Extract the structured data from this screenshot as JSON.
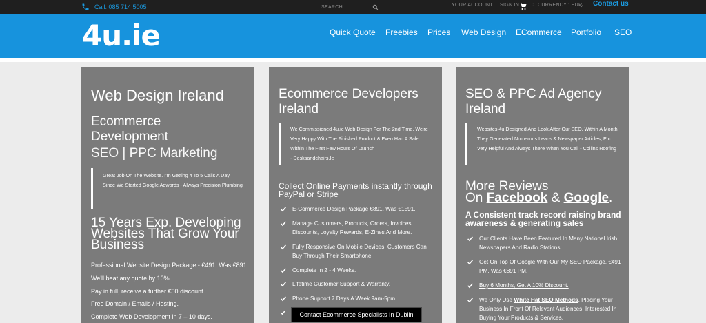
{
  "topbar": {
    "phone": "Call: 085 714 5005",
    "search_placeholder": "SEARCH...",
    "your_account": "YOUR ACCOUNT",
    "sign_in": "SIGN IN",
    "cart_count": "0",
    "currency": "CURRENCY : EUR",
    "contact_us": "Contact us"
  },
  "header": {
    "logo": "4u.ie",
    "nav": [
      "Quick Quote",
      "Freebies",
      "Prices",
      "Web Design",
      "ECommerce",
      "Portfolio",
      "SEO"
    ]
  },
  "col1": {
    "title": "Web Design Ireland",
    "sub1": "Ecommerce Development",
    "sub2": "SEO | PPC Marketing",
    "quote": "Great Job On The Website. I'm Getting 4 To 5 Calls A Day Since We Started Google Adwords - Always Precision Plumbing",
    "heading": "15 Years Exp. Developing Websites That Grow Your Business",
    "lines": [
      "Professional Website Design Package - €491. Was €891.",
      "We'll beat any quote by 10%.",
      "Pay in full, receive a further €50 discount.",
      "Free Domain / Emails / Hosting.",
      "Complete Web Development in 7 – 10 days."
    ]
  },
  "col2": {
    "title": "Ecommerce Developers Ireland",
    "quote": "We Commissioned 4u.ie Web Design For The 2nd Time. We're Very Happy With The Finished Product & Even Had A Sale Within The First Few Hours Of Launch",
    "quote_author": "- Desksandchairs.Ie",
    "heading": "Collect Online Payments instantly through PayPal or Stripe",
    "items": [
      "E-Commerce Design Package €891. Was €1591.",
      "Manage Customers, Products, Orders, Invoices, Discounts, Loyalty Rewards, E-Zines And More.",
      "Fully Responsive On Mobile Devices. Customers Can Buy Through Their Smartphone.",
      "Complete In 2 - 4 Weeks.",
      "Lifetime Customer Support & Warranty.",
      "Phone Support 7 Days A Week 9am-5pm."
    ],
    "cta": "Contact Ecommerce Specialists In Dublin"
  },
  "col3": {
    "title": "SEO & PPC Ad Agency Ireland",
    "quote": "Websites 4u Designed And Look After Our SEO. Within A Month They Generated Numerous Leads & Newspaper Articles, Etc. Very Helpful And Always There When You Call - Collins Roofing",
    "more_reviews": "More Reviews",
    "on": "On",
    "facebook": "Facebook",
    "amp": "&",
    "google": "Google",
    "dot": ".",
    "tagline": "A Consistent track record raising brand awareness & generating sales",
    "item1": "Our Clients Have Been Featured In Many National Irish Newspapers And Radio Stations.",
    "item2": "Get On Top Of Google With Our My SEO Package. €491 PM. Was €891 PM.",
    "item3": "Buy 6 Months, Get A 10% Discount.",
    "item4_pre": "We Only Use",
    "item4_link": "White Hat SEO Methods",
    "item4_post": ", Placing Your Business In Front Of Relevant Audiences, Interested In Buying Your Products & Services."
  },
  "colors": {
    "blue": "#1793dd",
    "dark": "#1f1f1f",
    "panel": "#7b7b7b"
  }
}
